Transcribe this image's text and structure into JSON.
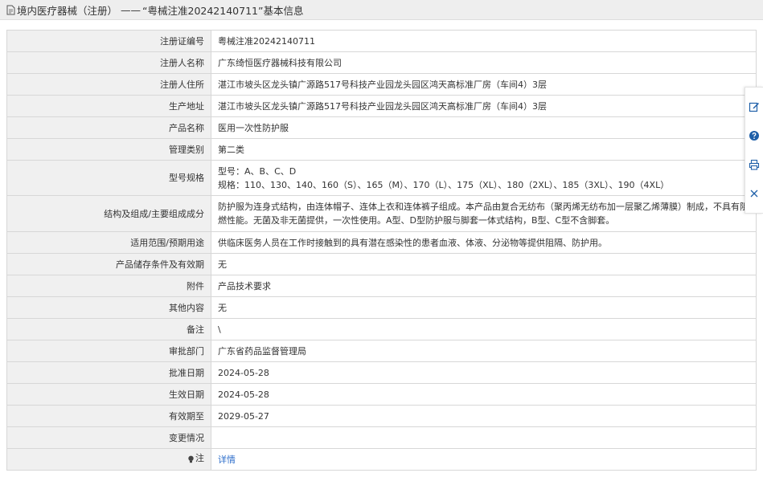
{
  "header": {
    "title_prefix": "境内医疗器械（注册）",
    "title_separator": "——",
    "title_main": "“粤械注准20242140711”基本信息"
  },
  "rows": [
    {
      "label": "注册证编号",
      "value": "粤械注准20242140711"
    },
    {
      "label": "注册人名称",
      "value": "广东绮恒医疗器械科技有限公司"
    },
    {
      "label": "注册人住所",
      "value": "湛江市坡头区龙头镇广源路517号科技产业园龙头园区鸿天高标准厂房（车间4）3层"
    },
    {
      "label": "生产地址",
      "value": "湛江市坡头区龙头镇广源路517号科技产业园龙头园区鸿天高标准厂房（车间4）3层"
    },
    {
      "label": "产品名称",
      "value": "医用一次性防护服"
    },
    {
      "label": "管理类别",
      "value": "第二类"
    },
    {
      "label": "型号规格",
      "line1": "型号：A、B、C、D",
      "line2": "规格：110、130、140、160（S）、165（M）、170（L）、175（XL）、180（2XL）、185（3XL）、190（4XL）"
    },
    {
      "label": "结构及组成/主要组成成分",
      "value": "防护服为连身式结构，由连体帽子、连体上衣和连体裤子组成。本产品由复合无纺布（聚丙烯无纺布加一层聚乙烯薄膜）制成，不具有阻燃性能。无菌及非无菌提供，一次性使用。A型、D型防护服与脚套一体式结构，B型、C型不含脚套。"
    },
    {
      "label": "适用范围/预期用途",
      "value": "供临床医务人员在工作时接触到的具有潜在感染性的患者血液、体液、分泌物等提供阻隔、防护用。"
    },
    {
      "label": "产品储存条件及有效期",
      "value": "无"
    },
    {
      "label": "附件",
      "value": "产品技术要求"
    },
    {
      "label": "其他内容",
      "value": "无"
    },
    {
      "label": "备注",
      "value": "\\"
    },
    {
      "label": "审批部门",
      "value": "广东省药品监督管理局"
    },
    {
      "label": "批准日期",
      "value": "2024-05-28"
    },
    {
      "label": "生效日期",
      "value": "2024-05-28"
    },
    {
      "label": "有效期至",
      "value": "2029-05-27"
    },
    {
      "label": "变更情况",
      "value": ""
    },
    {
      "label": "注",
      "value": "详情"
    }
  ],
  "side_tools": [
    "edit-icon",
    "help-icon",
    "print-icon",
    "close-icon"
  ],
  "colors": {
    "link": "#2f6fcb",
    "label_bg": "#f0f0f0",
    "title_bg": "#eeeeee",
    "icon_blue": "#1e5fa8"
  }
}
